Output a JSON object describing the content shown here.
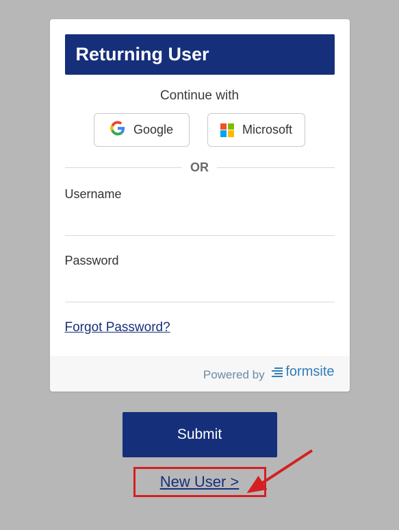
{
  "banner": {
    "title": "Returning User"
  },
  "social": {
    "continue_label": "Continue with",
    "google_label": "Google",
    "microsoft_label": "Microsoft"
  },
  "divider": {
    "text": "OR"
  },
  "fields": {
    "username_label": "Username",
    "password_label": "Password"
  },
  "links": {
    "forgot": "Forgot Password?",
    "newuser": "New User >"
  },
  "footer": {
    "powered_by": "Powered by",
    "brand": "formsite"
  },
  "actions": {
    "submit": "Submit"
  }
}
